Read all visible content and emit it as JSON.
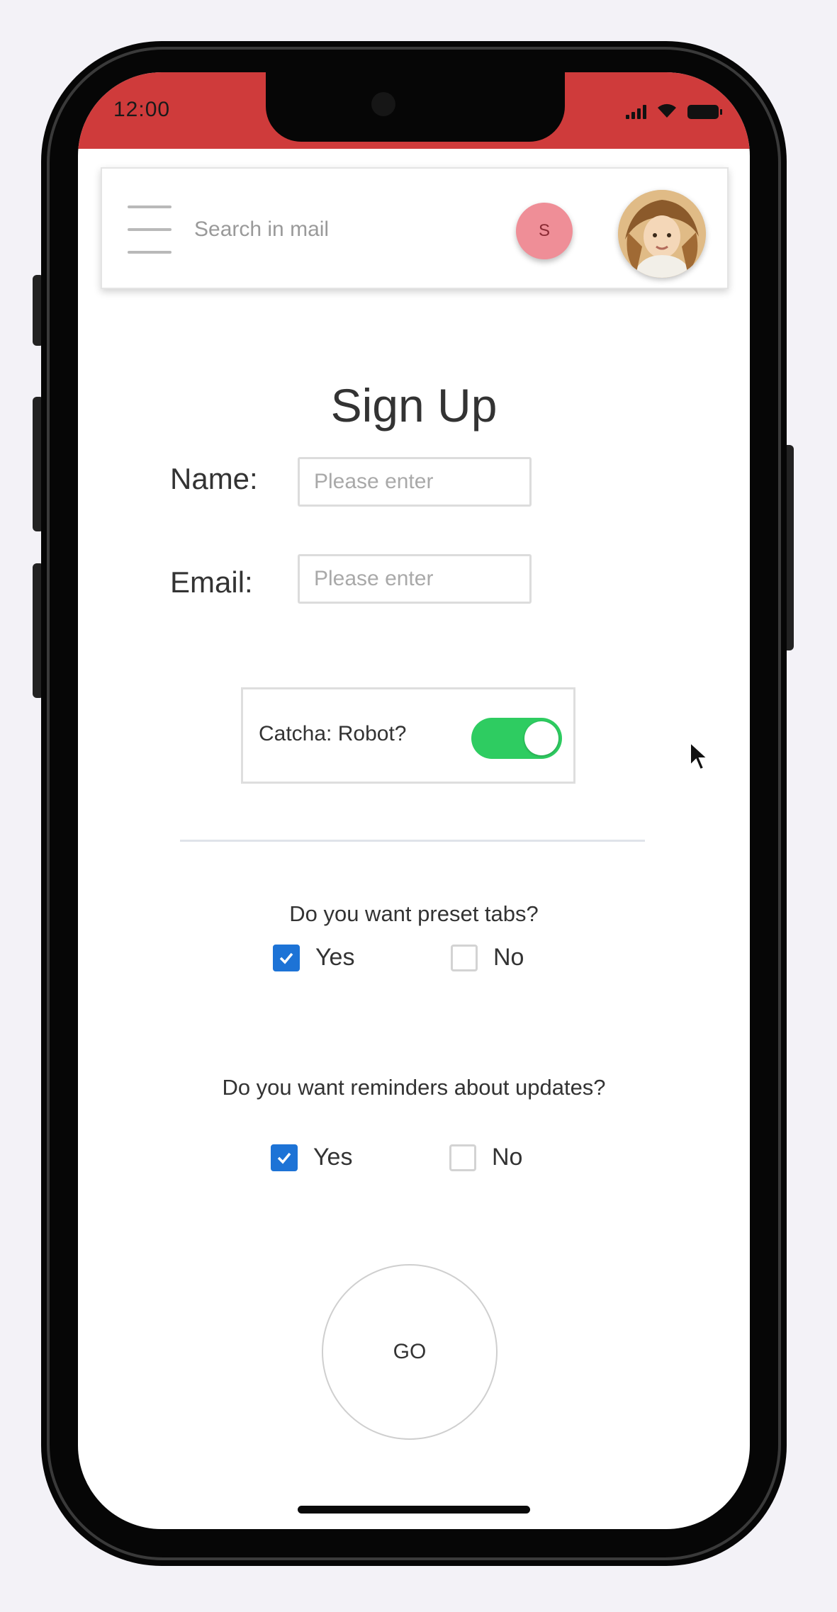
{
  "status_bar": {
    "time": "12:00",
    "color": "#cf3b3b",
    "icons": [
      "signal-icon",
      "wifi-icon",
      "battery-icon"
    ]
  },
  "app_bar": {
    "menu_icon": "hamburger-menu-icon",
    "search_placeholder": "Search in mail",
    "badge_letter": "S",
    "badge_color": "#ef8e97",
    "avatar": "user-avatar"
  },
  "form": {
    "title": "Sign Up",
    "name_label": "Name:",
    "name_placeholder": "Please enter",
    "email_label": "Email:",
    "email_placeholder": "Please enter",
    "captcha": {
      "label": "Catcha: Robot?",
      "enabled": true,
      "color": "#2ecc61"
    },
    "questions": [
      {
        "text": "Do you want preset tabs?",
        "options": [
          {
            "label": "Yes",
            "checked": true
          },
          {
            "label": "No",
            "checked": false
          }
        ]
      },
      {
        "text": "Do you want reminders about updates?",
        "options": [
          {
            "label": "Yes",
            "checked": true
          },
          {
            "label": "No",
            "checked": false
          }
        ]
      }
    ],
    "checkbox_color": "#1d73d6",
    "submit_label": "GO"
  }
}
